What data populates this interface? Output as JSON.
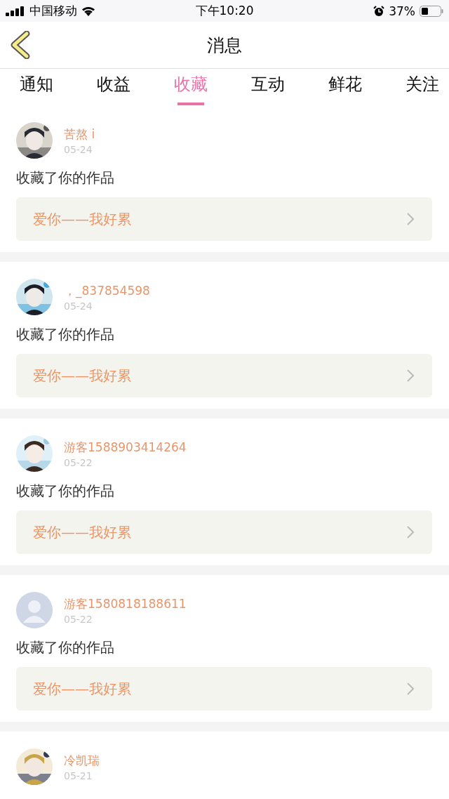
{
  "status_bar": {
    "carrier": "中国移动",
    "time": "下午10:20",
    "battery": "37%"
  },
  "nav": {
    "title": "消息"
  },
  "tabs": [
    {
      "label": "通知",
      "selected": false
    },
    {
      "label": "收益",
      "selected": false
    },
    {
      "label": "收藏",
      "selected": true
    },
    {
      "label": "互动",
      "selected": false
    },
    {
      "label": "鲜花",
      "selected": false
    },
    {
      "label": "关注",
      "selected": false
    }
  ],
  "items": [
    {
      "name": "苦熬 i",
      "date": "05-24",
      "message": "收藏了你的作品",
      "work": "爱你——我好累"
    },
    {
      "name": "，_837854598",
      "date": "05-24",
      "message": "收藏了你的作品",
      "work": "爱你——我好累"
    },
    {
      "name": "游客1588903414264",
      "date": "05-22",
      "message": "收藏了你的作品",
      "work": "爱你——我好累"
    },
    {
      "avatar": {
        "kind": "default"
      },
      "name": "游客1580818188611",
      "date": "05-22",
      "message": "收藏了你的作品",
      "work": "爱你——我好累"
    },
    {
      "name": "冷凯瑞",
      "date": "05-21"
    }
  ]
}
